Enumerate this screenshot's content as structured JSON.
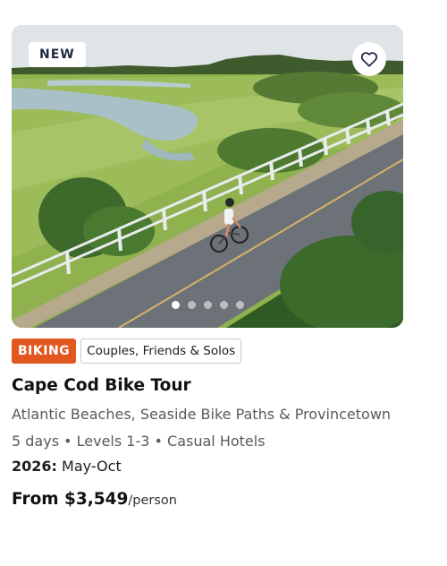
{
  "card": {
    "badge": "NEW",
    "favorite_icon": "heart-outline-icon",
    "carousel": {
      "total": 5,
      "active_index": 0
    },
    "tags": {
      "activity": "BIKING",
      "audience": "Couples, Friends & Solos"
    },
    "title": "Cape Cod Bike Tour",
    "subtitle": "Atlantic Beaches, Seaside Bike Paths & Provincetown",
    "meta": "5 days • Levels 1-3 • Casual Hotels",
    "season_year": "2026:",
    "season_months": "May-Oct",
    "price_prefix": "From $3,549",
    "price_unit": "/person"
  },
  "colors": {
    "activity_tag": "#e2571e",
    "title_text": "#111111",
    "muted_text": "#5a5a5a"
  }
}
